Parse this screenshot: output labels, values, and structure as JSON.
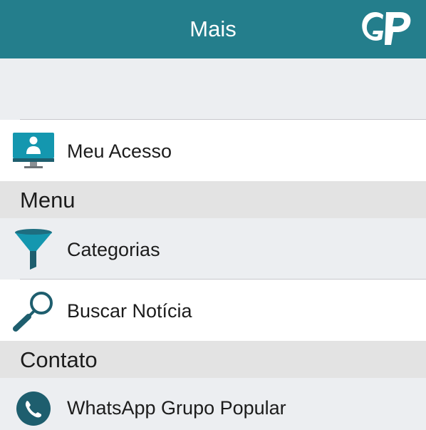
{
  "header": {
    "title": "Mais",
    "logo_text": "GP"
  },
  "items": {
    "meu_acesso": {
      "label": "Meu Acesso",
      "icon": "computer-user-icon"
    },
    "categorias": {
      "label": "Categorias",
      "icon": "funnel-icon"
    },
    "buscar": {
      "label": "Buscar Notícia",
      "icon": "magnifier-icon"
    },
    "whatsapp": {
      "label": "WhatsApp Grupo Popular",
      "icon": "phone-icon"
    }
  },
  "sections": {
    "menu": "Menu",
    "contato": "Contato"
  },
  "colors": {
    "header": "#247E8C",
    "background": "#ECEEF1",
    "section": "#E3E3E3",
    "icon_teal": "#1497AF",
    "icon_dark": "#1E5E6E"
  }
}
